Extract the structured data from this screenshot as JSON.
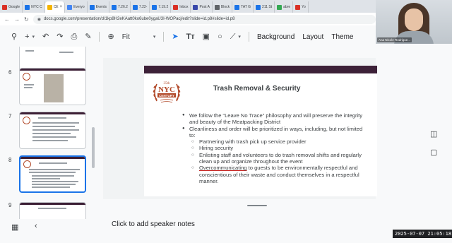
{
  "browser": {
    "tabs": [
      {
        "label": "Google",
        "color": "#d93025",
        "active": false
      },
      {
        "label": "NYC C",
        "color": "#1a73e8",
        "active": false
      },
      {
        "label": "CE",
        "color": "#f4b400",
        "active": true
      },
      {
        "label": "Everyo",
        "color": "#4285f4",
        "active": false
      },
      {
        "label": "Events",
        "color": "#1a73e8",
        "active": false
      },
      {
        "label": "7.26.2",
        "color": "#1a73e8",
        "active": false
      },
      {
        "label": "7.22-",
        "color": "#1a73e8",
        "active": false
      },
      {
        "label": "7.19.2",
        "color": "#1a73e8",
        "active": false
      },
      {
        "label": "Inbox",
        "color": "#d93025",
        "active": false
      },
      {
        "label": "Post A",
        "color": "#3949ab",
        "active": false
      },
      {
        "label": "Block",
        "color": "#5f6368",
        "active": false
      },
      {
        "label": "TAT G",
        "color": "#1a73e8",
        "active": false
      },
      {
        "label": "211 St",
        "color": "#1a73e8",
        "active": false
      },
      {
        "label": "abre",
        "color": "#34a853",
        "active": false
      },
      {
        "label": "Yo",
        "color": "#d93025",
        "active": false
      }
    ],
    "url": "docs.google.com/presentation/d/1kp8H2eKAatt0ko6ube0ygaU3I-WOPacj/edit?slide=id.p8#slide=id.p8"
  },
  "toolbar": {
    "zoom_label": "Fit",
    "background_label": "Background",
    "layout_label": "Layout",
    "theme_label": "Theme"
  },
  "filmstrip": {
    "slide_numbers": [
      "6",
      "7",
      "8",
      "9"
    ],
    "selected": "8"
  },
  "slide": {
    "logo": {
      "line1": "35th",
      "line2": "NYC",
      "line3": "CENTURY",
      "color": "#b24a2a"
    },
    "title": "Trash Removal & Security",
    "bullets": [
      {
        "level": 1,
        "text": "We follow the “Leave No Trace” philosophy and will preserve the integrity and beauty of the Meatpacking District"
      },
      {
        "level": 1,
        "text": "Cleanliness and order will be prioritized in ways, including, but not limited to:"
      },
      {
        "level": 2,
        "text": "Partnering with trash pick up service provider"
      },
      {
        "level": 2,
        "text": "Hiring security"
      },
      {
        "level": 2,
        "text": "Enlisting staff and volunteers to do trash removal shifts and regularly clean up and organize throughout the event"
      },
      {
        "level": 2,
        "underlined": "Overcommunicating",
        "text": " to guests to be environmentally respectful and conscientious of their waste and conduct themselves in a respectful manner."
      }
    ]
  },
  "notes": {
    "placeholder": "Click to add speaker notes"
  },
  "webcam": {
    "name": "Ana Nicole Rodrigue..."
  },
  "timestamp": "2025-07-07 21:05:18"
}
